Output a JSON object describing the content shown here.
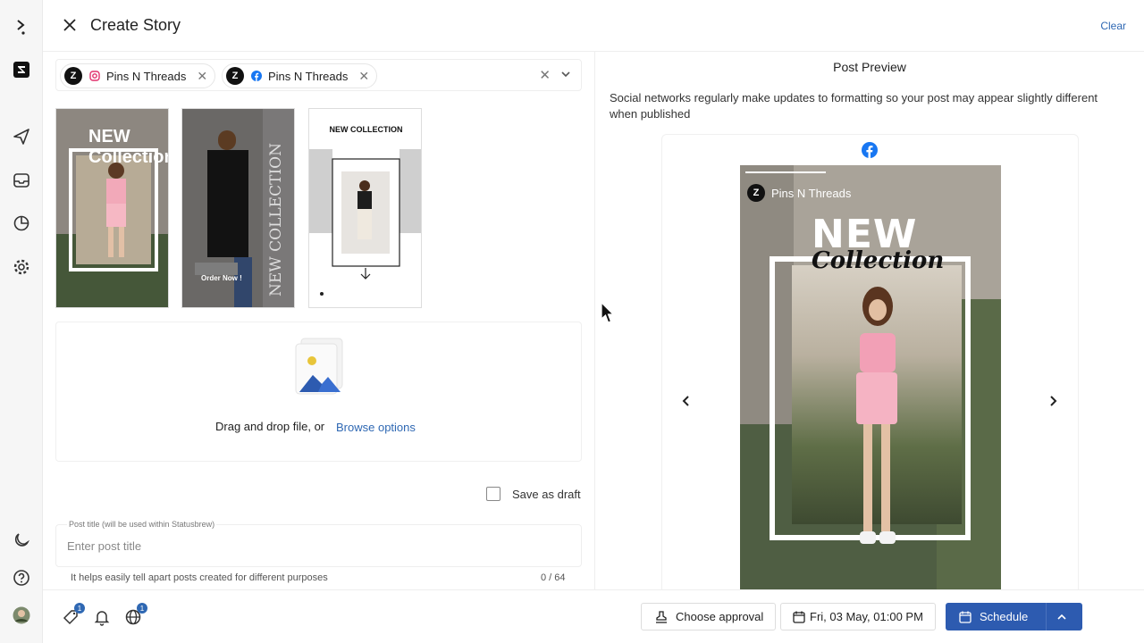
{
  "header": {
    "title": "Create Story",
    "clear_label": "Clear"
  },
  "accounts": [
    {
      "name": "Pins N Threads",
      "network": "instagram"
    },
    {
      "name": "Pins N Threads",
      "network": "facebook"
    }
  ],
  "media": {
    "thumbnails": [
      {
        "label": "NEW Collection"
      },
      {
        "label": "NEW COLLECTION",
        "cta": "Order Now !"
      },
      {
        "label": "NEW COLLECTION"
      }
    ]
  },
  "dropzone": {
    "text": "Drag and drop file, or",
    "link": "Browse options"
  },
  "draft": {
    "label": "Save as draft",
    "checked": false
  },
  "post_title": {
    "legend": "Post title (will be used within Statusbrew)",
    "placeholder": "Enter post title",
    "help": "It helps easily tell apart posts created for different purposes",
    "counter": "0 / 64"
  },
  "preview": {
    "title": "Post Preview",
    "note": "Social networks regularly make updates to formatting so your post may appear slightly different when published",
    "network_icon": "facebook-icon",
    "account_name": "Pins N Threads",
    "story_headline": "NEW",
    "story_subheadline": "Collection"
  },
  "footer": {
    "approval_label": "Choose approval",
    "date_label": "Fri, 03 May, 01:00 PM",
    "schedule_label": "Schedule",
    "tag_badge": "1",
    "globe_badge": "1"
  },
  "colors": {
    "accent": "#2f68b3",
    "schedule_button": "#2d5bb0",
    "instagram": "#e1306c",
    "facebook": "#1877f2"
  }
}
